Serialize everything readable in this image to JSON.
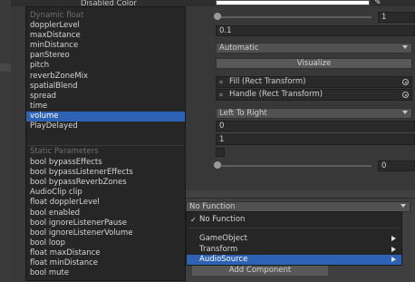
{
  "inspector": {
    "disabled_color_label": "Disabled Color",
    "color_swatch": "#ffffff",
    "picker_icon": "eyedropper-icon",
    "slider1_value": "1",
    "field_0_1": "0.1",
    "navigation_mode": "Automatic",
    "visualize_label": "Visualize",
    "fill_rect": "Fill (Rect Transform)",
    "handle_rect": "Handle (Rect Transform)",
    "direction": "Left To Right",
    "min_value": "0",
    "max_value": "1",
    "slider2_value": "0",
    "no_function_label": "No Function",
    "add_component_label": "Add Component"
  },
  "menu": {
    "dynamic_header": "Dynamic float",
    "dynamic_items": [
      "dopplerLevel",
      "maxDistance",
      "minDistance",
      "panStereo",
      "pitch",
      "reverbZoneMix",
      "spatialBlend",
      "spread",
      "time",
      "volume",
      "PlayDelayed"
    ],
    "selected_index": 9,
    "static_header": "Static Parameters",
    "static_items": [
      "bool bypassEffects",
      "bool bypassListenerEffects",
      "bool bypassReverbZones",
      "AudioClip clip",
      "float dopplerLevel",
      "bool enabled",
      "bool ignoreListenerPause",
      "bool ignoreListenerVolume",
      "bool loop",
      "float maxDistance",
      "float minDistance",
      "bool mute"
    ]
  },
  "submenu": {
    "check_icon": "checkmark-icon",
    "no_function": "No Function",
    "items": [
      {
        "label": "GameObject",
        "selected": false
      },
      {
        "label": "Transform",
        "selected": false
      },
      {
        "label": "AudioSource",
        "selected": true
      }
    ]
  },
  "colors": {
    "accent": "#2d62b4",
    "menu_bg": "#262626",
    "inspector_bg": "#383838"
  }
}
